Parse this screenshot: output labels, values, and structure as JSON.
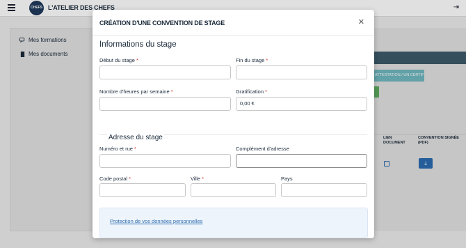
{
  "header": {
    "brand": "L'ATELIER DES CHEFS",
    "logo_text": "CHEFS",
    "menu_icon": "hamburger-icon",
    "logout_icon": "logout-icon"
  },
  "sidebar": {
    "items": [
      {
        "label": "Mes formations",
        "icon": "chat-icon"
      },
      {
        "label": "Mes documents",
        "icon": "document-icon"
      }
    ]
  },
  "background": {
    "certificate_button": "ATTESTATION / UN CERTIFICAT",
    "col_link_document": "LIEN DOCUMENT",
    "col_signed_convention": "CONVENTION SIGNÉE (PDF)"
  },
  "modal": {
    "title": "CRÉATION D'UNE CONVENTION DE STAGE",
    "close_icon": "close-icon",
    "section_info": "Informations du stage",
    "section_address": "Adresse du stage",
    "fields": {
      "start_date": {
        "label": "Début du stage",
        "value": ""
      },
      "end_date": {
        "label": "Fin du stage",
        "value": ""
      },
      "hours_per_week": {
        "label": "Nombre d'heures par semaine",
        "value": ""
      },
      "gratification": {
        "label": "Gratification",
        "value": "0,00 €"
      },
      "street": {
        "label": "Numéro et rue",
        "value": ""
      },
      "address_complement": {
        "label": "Complément d'adresse",
        "value": ""
      },
      "postal_code": {
        "label": "Code postal",
        "value": ""
      },
      "city": {
        "label": "Ville",
        "value": ""
      },
      "country": {
        "label": "Pays",
        "value": ""
      }
    },
    "required_mark": "*",
    "privacy_link": "Protection de vos données personnelles"
  }
}
